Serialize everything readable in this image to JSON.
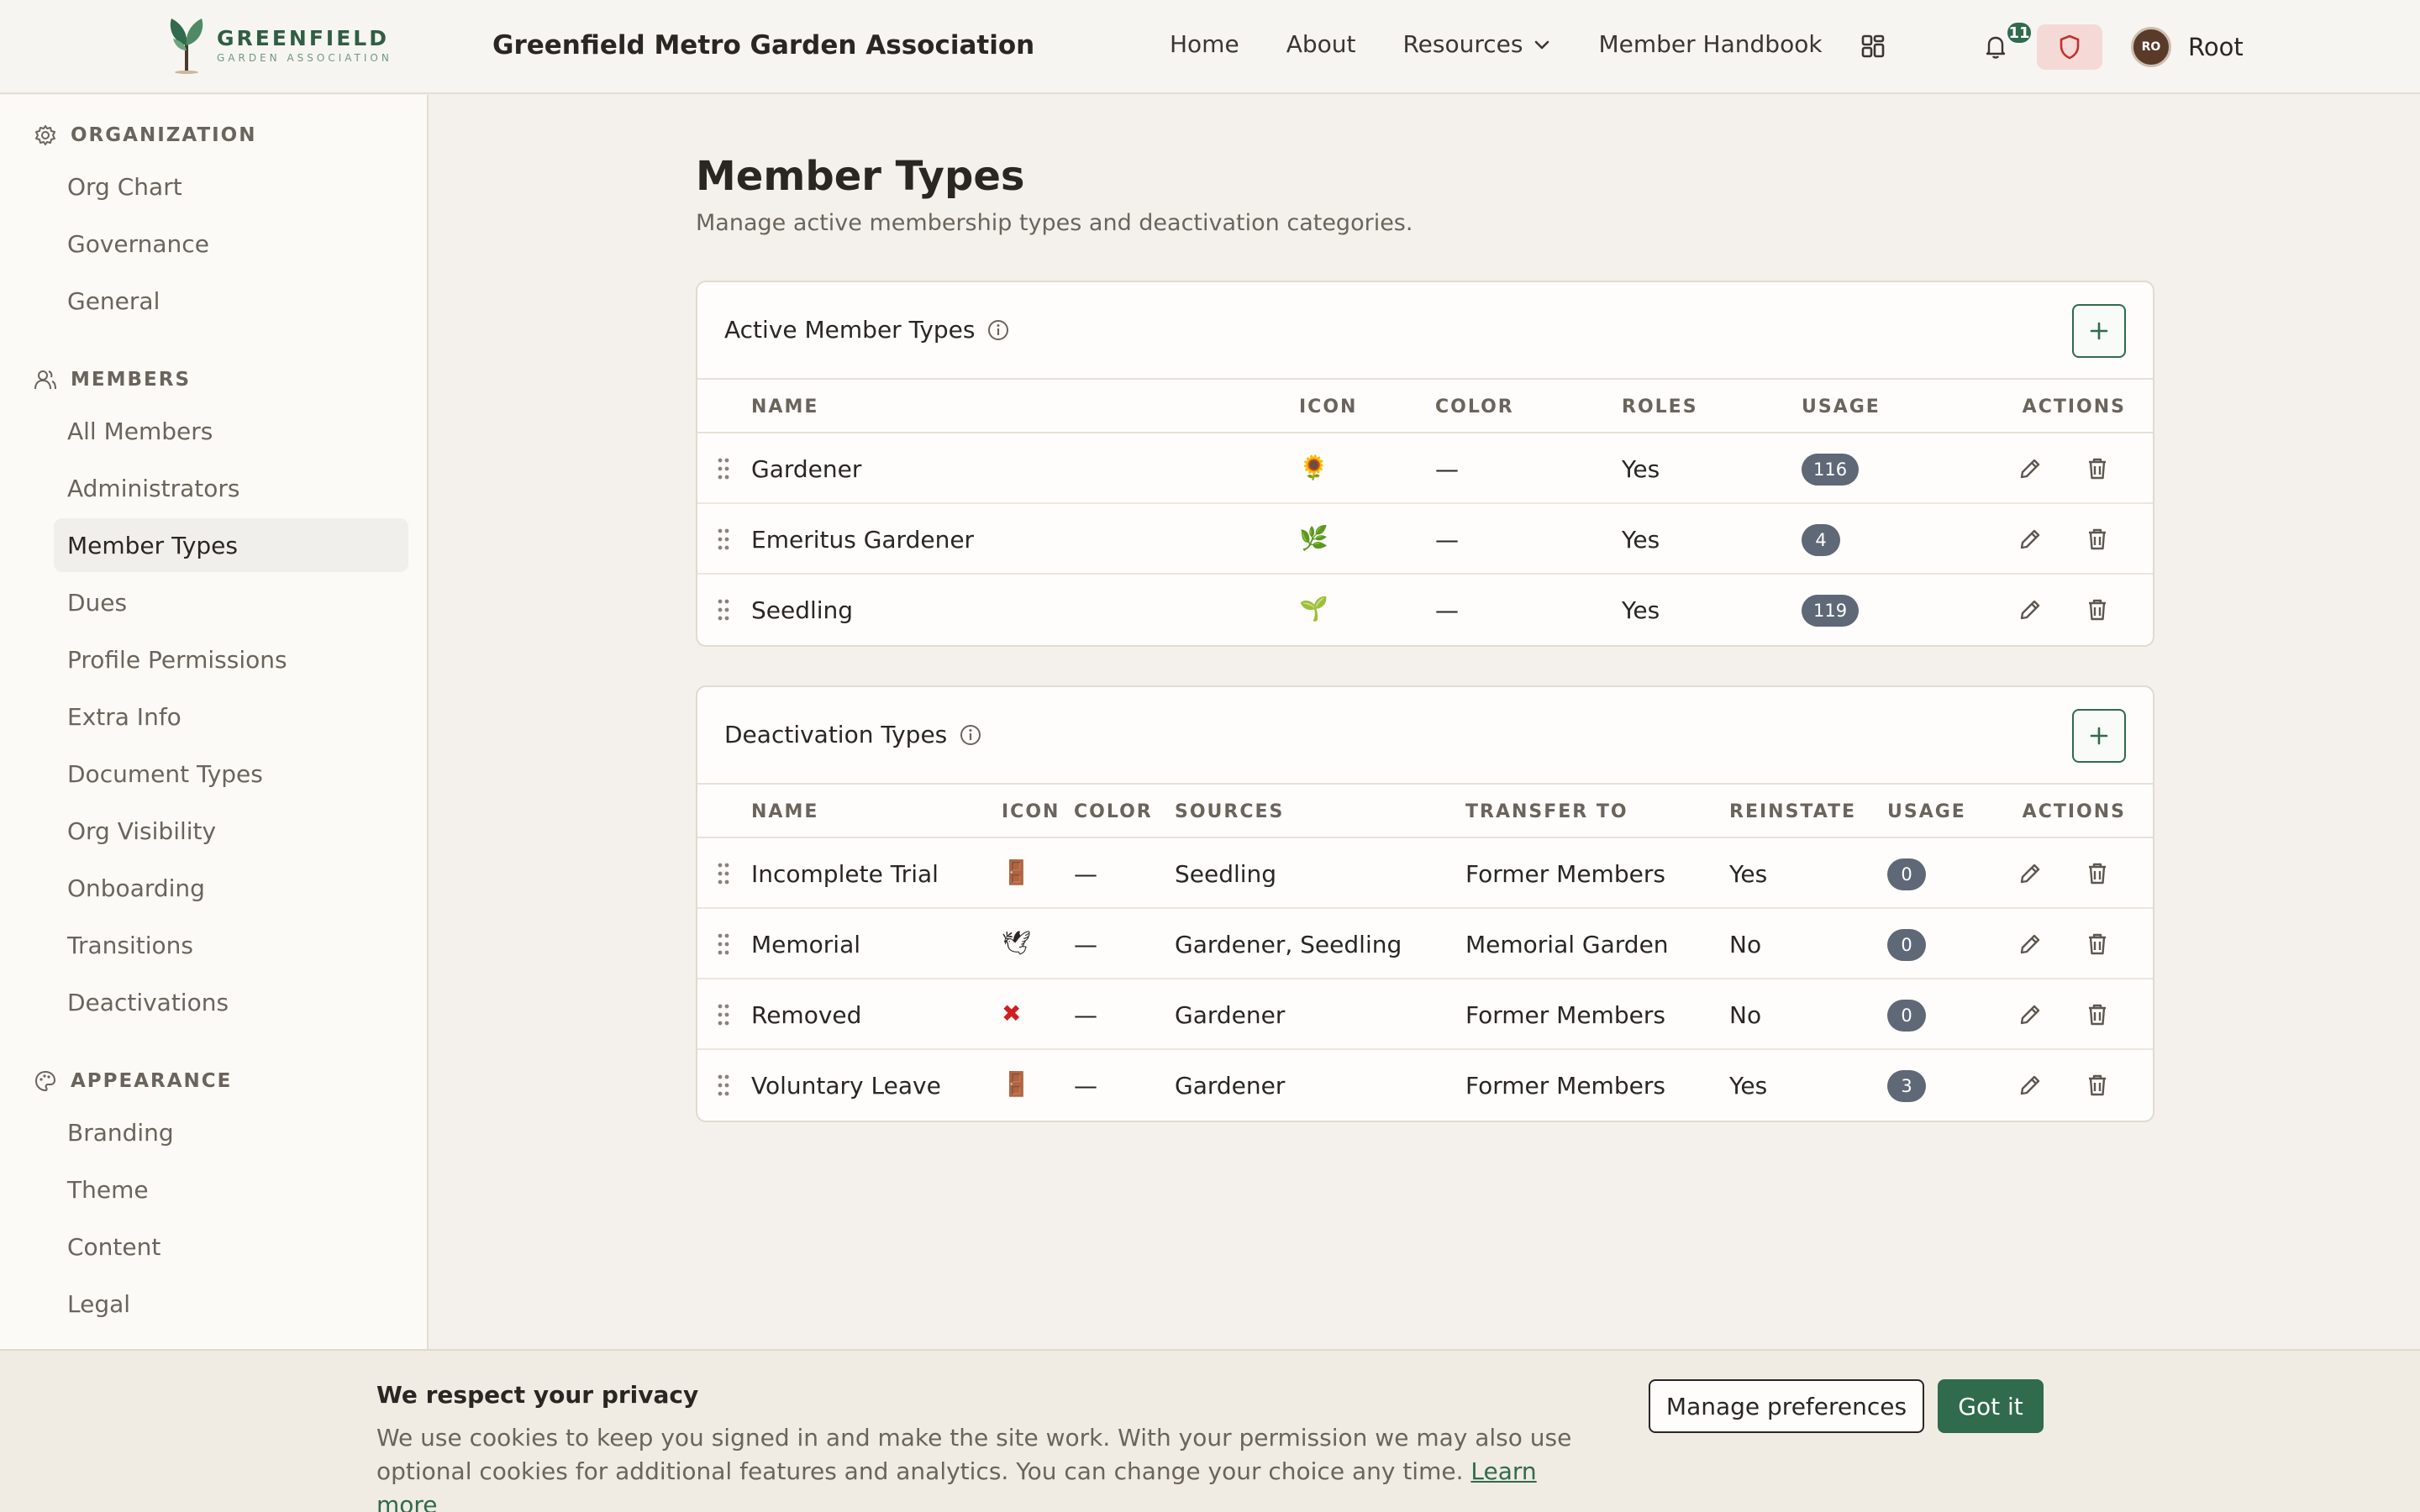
{
  "header": {
    "logo_name": "GREENFIELD",
    "logo_sub": "GARDEN ASSOCIATION",
    "app_title": "Greenfield Metro Garden Association",
    "nav": [
      {
        "label": "Home"
      },
      {
        "label": "About"
      },
      {
        "label": "Resources"
      },
      {
        "label": "Member Handbook"
      }
    ],
    "notification_count": "11",
    "user": {
      "initials": "RO",
      "name": "Root"
    }
  },
  "sidebar": {
    "organization": {
      "title": "ORGANIZATION",
      "items": [
        "Org Chart",
        "Governance",
        "General"
      ]
    },
    "members": {
      "title": "MEMBERS",
      "items": [
        "All Members",
        "Administrators",
        "Member Types",
        "Dues",
        "Profile Permissions",
        "Extra Info",
        "Document Types",
        "Org Visibility",
        "Onboarding",
        "Transitions",
        "Deactivations"
      ]
    },
    "appearance": {
      "title": "APPEARANCE",
      "items": [
        "Branding",
        "Theme",
        "Content",
        "Legal"
      ]
    },
    "active_item": "Member Types"
  },
  "main": {
    "title": "Member Types",
    "subtitle": "Manage active membership types and deactivation categories.",
    "active_types": {
      "title": "Active Member Types",
      "columns": [
        "NAME",
        "ICON",
        "COLOR",
        "ROLES",
        "USAGE",
        "ACTIONS"
      ],
      "rows": [
        {
          "name": "Gardener",
          "icon": "🌻",
          "color": "—",
          "roles": "Yes",
          "usage": "116"
        },
        {
          "name": "Emeritus Gardener",
          "icon": "🌿",
          "color": "—",
          "roles": "Yes",
          "usage": "4"
        },
        {
          "name": "Seedling",
          "icon": "🌱",
          "color": "—",
          "roles": "Yes",
          "usage": "119"
        }
      ]
    },
    "deactivation_types": {
      "title": "Deactivation Types",
      "columns": [
        "NAME",
        "ICON",
        "COLOR",
        "SOURCES",
        "TRANSFER TO",
        "REINSTATE",
        "USAGE",
        "ACTIONS"
      ],
      "rows": [
        {
          "name": "Incomplete Trial",
          "icon": "🚪",
          "color": "—",
          "sources": "Seedling",
          "transfer_to": "Former Members",
          "reinstate": "Yes",
          "usage": "0"
        },
        {
          "name": "Memorial",
          "icon": "🕊",
          "color": "—",
          "sources": "Gardener, Seedling",
          "transfer_to": "Memorial Garden",
          "reinstate": "No",
          "usage": "0"
        },
        {
          "name": "Removed",
          "icon": "✖",
          "color": "—",
          "sources": "Gardener",
          "transfer_to": "Former Members",
          "reinstate": "No",
          "usage": "0"
        },
        {
          "name": "Voluntary Leave",
          "icon": "🚪",
          "color": "—",
          "sources": "Gardener",
          "transfer_to": "Former Members",
          "reinstate": "Yes",
          "usage": "3"
        }
      ]
    }
  },
  "cookie": {
    "title": "We respect your privacy",
    "text": "We use cookies to keep you signed in and make the site work. With your permission we may also use optional cookies for additional features and analytics. You can change your choice any time.",
    "learn_more": "Learn more",
    "manage_label": "Manage preferences",
    "accept_label": "Got it"
  },
  "colors": {
    "brand_green": "#2f6b4c",
    "badge_gray": "#5f6877",
    "background": "#f4f1ec",
    "removed_red": "#d11f1f"
  }
}
